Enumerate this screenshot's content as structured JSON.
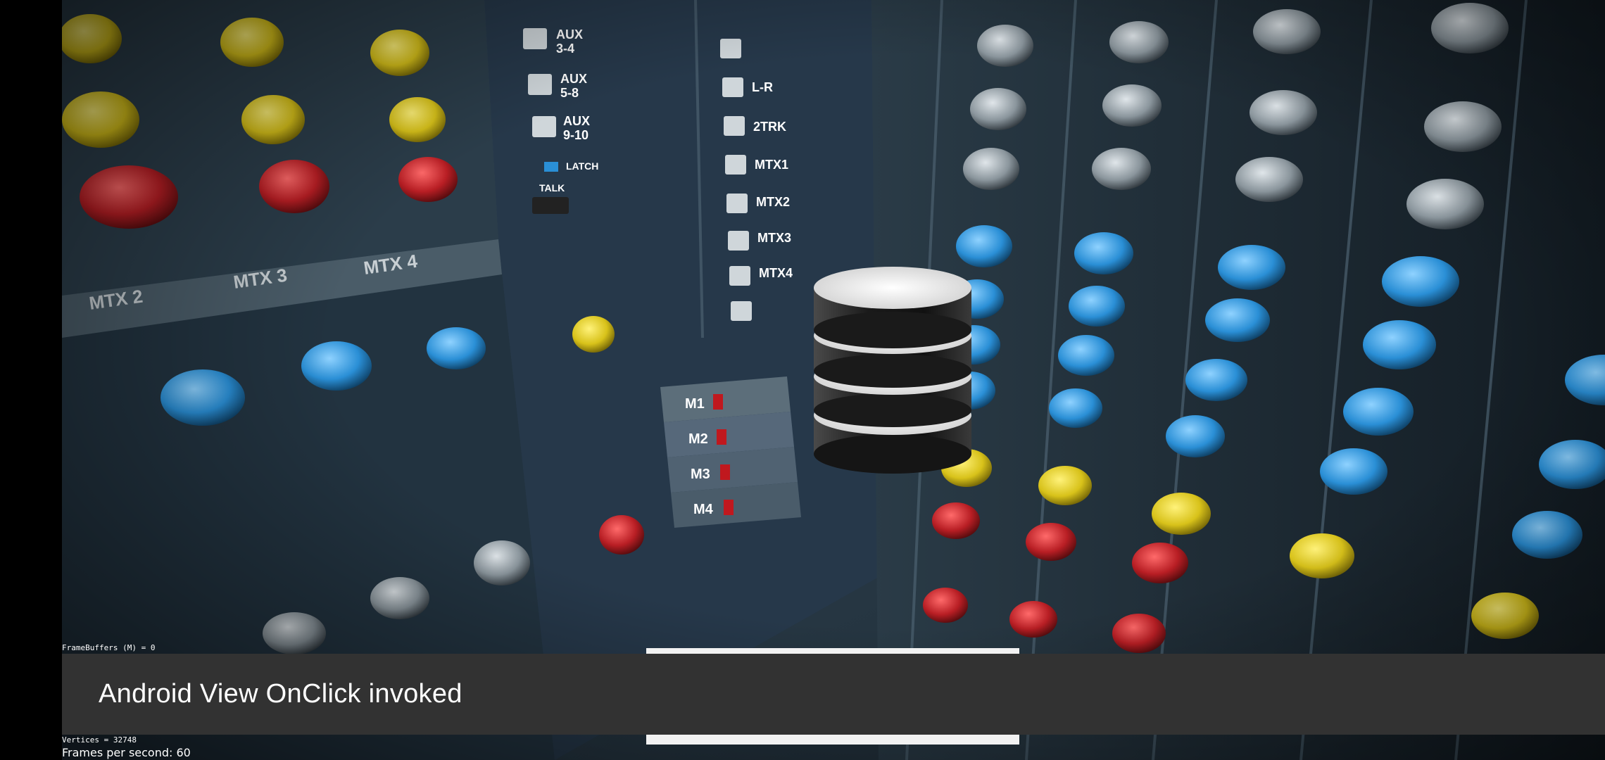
{
  "debug": {
    "framebuffers": "FrameBuffers (M) = 0",
    "vertices": "Vertices = 32748",
    "fps": "Frames per second: 60"
  },
  "snackbar": {
    "message": "Android View OnClick invoked"
  },
  "scene": {
    "description_icon": "mixing-console-photo",
    "object_icon": "stacked-disks-3d",
    "console_labels": {
      "aux_buttons": [
        "AUX\n3-4",
        "AUX\n5-8",
        "AUX\n9-10"
      ],
      "latch": "LATCH",
      "talk": "TALK",
      "routing": [
        "L-R",
        "2TRK",
        "MTX1",
        "MTX2",
        "MTX3",
        "MTX4"
      ],
      "mute_groups": [
        "M1",
        "M2",
        "M3",
        "M4"
      ],
      "mtx_strips": [
        "MTX 2",
        "MTX 3",
        "MTX 4"
      ]
    }
  },
  "colors": {
    "snackbar_bg": "#323232",
    "knob_yellow": "#d8c21a",
    "knob_red": "#b81e24",
    "knob_blue": "#2a8fd6"
  }
}
